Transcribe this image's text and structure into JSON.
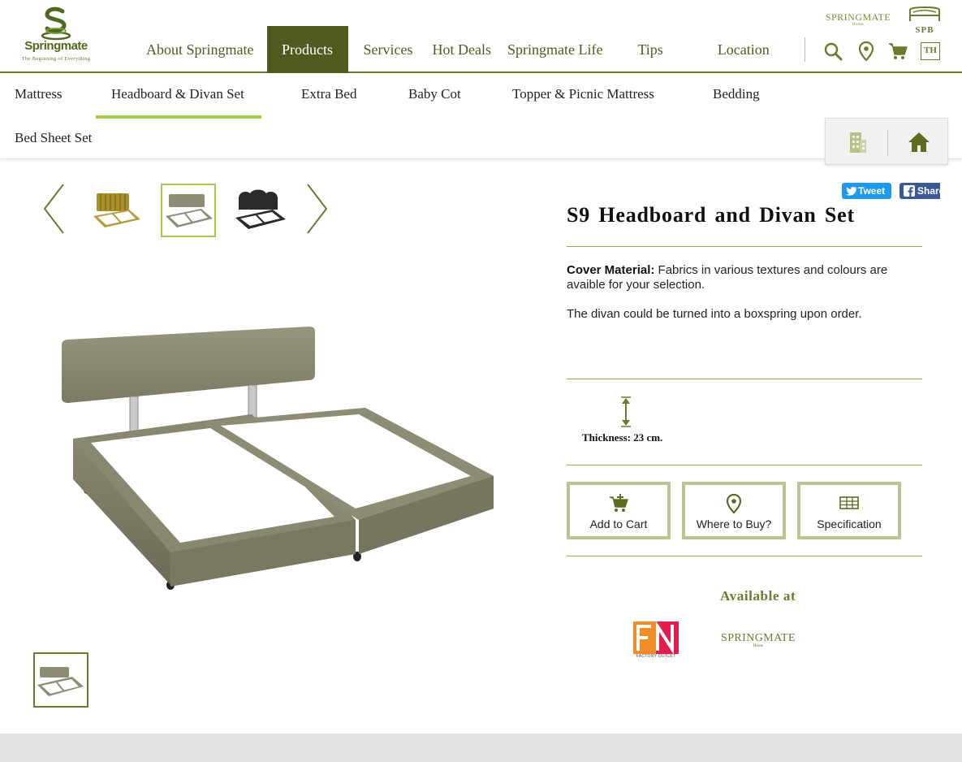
{
  "brand": {
    "name": "Springmate",
    "tagline": "The Beginning of Everything"
  },
  "top_brands": {
    "springmate_home": "SPRINGMATE",
    "springmate_home_sub": "Home",
    "spb": "SPB"
  },
  "main_nav": {
    "items": [
      {
        "label": "About Springmate"
      },
      {
        "label": "Products"
      },
      {
        "label": "Services"
      },
      {
        "label": "Hot Deals"
      },
      {
        "label": "Springmate Life"
      },
      {
        "label": "Tips"
      },
      {
        "label": "Location"
      }
    ],
    "active": "Products",
    "language": "TH"
  },
  "utility_icons": [
    "search-icon",
    "location-pin-icon",
    "cart-icon"
  ],
  "sub_nav": {
    "items": [
      {
        "label": "Mattress"
      },
      {
        "label": "Headboard & Divan Set"
      },
      {
        "label": "Extra Bed"
      },
      {
        "label": "Baby Cot"
      },
      {
        "label": "Topper & Picnic Mattress"
      },
      {
        "label": "Bedding"
      },
      {
        "label": "Bed Sheet Set"
      }
    ],
    "active": "Headboard & Divan Set"
  },
  "quick_links": [
    "building-icon",
    "home-icon"
  ],
  "share": {
    "tweet": "Tweet",
    "facebook": "Share"
  },
  "product": {
    "title": "S9 Headboard and Divan Set",
    "cover_label": "Cover Material:",
    "cover_text": "Fabrics in various textures and colours are avaible for your selection.",
    "note": "The divan could be turned into a boxspring upon order.",
    "thickness": "Thickness: 23 cm.",
    "gallery_selected": 2
  },
  "actions": {
    "add_to_cart": "Add to Cart",
    "where_to_buy": "Where to Buy?",
    "specification": "Specification"
  },
  "availability": {
    "heading": "Available at",
    "retailers": [
      {
        "name": "FN",
        "sub": "FACTORY OUTLET"
      },
      {
        "name": "SPRINGMATE",
        "sub": "Home"
      }
    ]
  },
  "colors": {
    "brand_dark": "#4f5b1e",
    "brand_mid": "#6b7a2c",
    "accent_green": "#a9c94a",
    "button_border": "#b8c491",
    "footer": "#e3e3e3"
  }
}
